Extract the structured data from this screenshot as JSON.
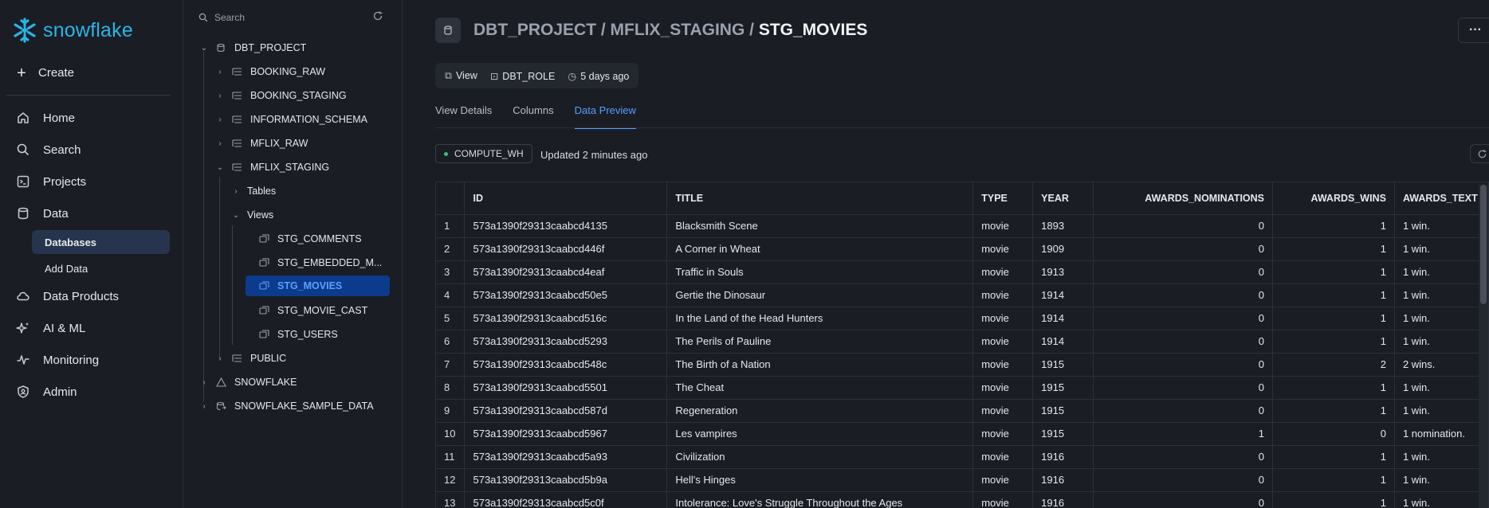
{
  "nav": {
    "logo_text": "snowflake",
    "create_label": "Create",
    "items": [
      {
        "label": "Home",
        "icon": "home-icon"
      },
      {
        "label": "Search",
        "icon": "search-icon"
      },
      {
        "label": "Projects",
        "icon": "projects-icon"
      },
      {
        "label": "Data",
        "icon": "database-icon"
      },
      {
        "label": "Data Products",
        "icon": "cloud-icon"
      },
      {
        "label": "AI & ML",
        "icon": "sparkle-icon"
      },
      {
        "label": "Monitoring",
        "icon": "pulse-icon"
      },
      {
        "label": "Admin",
        "icon": "shield-icon"
      }
    ],
    "data_sub": [
      "Databases",
      "Add Data"
    ]
  },
  "tree": {
    "search_placeholder": "Search",
    "nodes": [
      "DBT_PROJECT",
      "BOOKING_RAW",
      "BOOKING_STAGING",
      "INFORMATION_SCHEMA",
      "MFLIX_RAW",
      "MFLIX_STAGING",
      "Tables",
      "Views",
      "STG_COMMENTS",
      "STG_EMBEDDED_M...",
      "STG_MOVIES",
      "STG_MOVIE_CAST",
      "STG_USERS",
      "PUBLIC",
      "SNOWFLAKE",
      "SNOWFLAKE_SAMPLE_DATA"
    ]
  },
  "header": {
    "crumb_prefix": "DBT_PROJECT / MFLIX_STAGING / ",
    "crumb_current": "STG_MOVIES",
    "more_label": "···",
    "meta": {
      "type": "View",
      "role": "DBT_ROLE",
      "time": "5 days ago"
    }
  },
  "tabs": [
    "View Details",
    "Columns",
    "Data Preview"
  ],
  "preview": {
    "warehouse": "COMPUTE_WH",
    "updated": "Updated 2 minutes ago",
    "columns": [
      "ID",
      "TITLE",
      "TYPE",
      "YEAR",
      "AWARDS_NOMINATIONS",
      "AWARDS_WINS",
      "AWARDS_TEXT"
    ],
    "rows": [
      [
        "1",
        "573a1390f29313caabcd4135",
        "Blacksmith Scene",
        "movie",
        "1893",
        "0",
        "1",
        "1 win."
      ],
      [
        "2",
        "573a1390f29313caabcd446f",
        "A Corner in Wheat",
        "movie",
        "1909",
        "0",
        "1",
        "1 win."
      ],
      [
        "3",
        "573a1390f29313caabcd4eaf",
        "Traffic in Souls",
        "movie",
        "1913",
        "0",
        "1",
        "1 win."
      ],
      [
        "4",
        "573a1390f29313caabcd50e5",
        "Gertie the Dinosaur",
        "movie",
        "1914",
        "0",
        "1",
        "1 win."
      ],
      [
        "5",
        "573a1390f29313caabcd516c",
        "In the Land of the Head Hunters",
        "movie",
        "1914",
        "0",
        "1",
        "1 win."
      ],
      [
        "6",
        "573a1390f29313caabcd5293",
        "The Perils of Pauline",
        "movie",
        "1914",
        "0",
        "1",
        "1 win."
      ],
      [
        "7",
        "573a1390f29313caabcd548c",
        "The Birth of a Nation",
        "movie",
        "1915",
        "0",
        "2",
        "2 wins."
      ],
      [
        "8",
        "573a1390f29313caabcd5501",
        "The Cheat",
        "movie",
        "1915",
        "0",
        "1",
        "1 win."
      ],
      [
        "9",
        "573a1390f29313caabcd587d",
        "Regeneration",
        "movie",
        "1915",
        "0",
        "1",
        "1 win."
      ],
      [
        "10",
        "573a1390f29313caabcd5967",
        "Les vampires",
        "movie",
        "1915",
        "1",
        "0",
        "1 nomination."
      ],
      [
        "11",
        "573a1390f29313caabcd5a93",
        "Civilization",
        "movie",
        "1916",
        "0",
        "1",
        "1 win."
      ],
      [
        "12",
        "573a1390f29313caabcd5b9a",
        "Hell's Hinges",
        "movie",
        "1916",
        "0",
        "1",
        "1 win."
      ],
      [
        "13",
        "573a1390f29313caabcd5c0f",
        "Intolerance: Love's Struggle Throughout the Ages",
        "movie",
        "1916",
        "0",
        "1",
        "1 win."
      ]
    ]
  }
}
